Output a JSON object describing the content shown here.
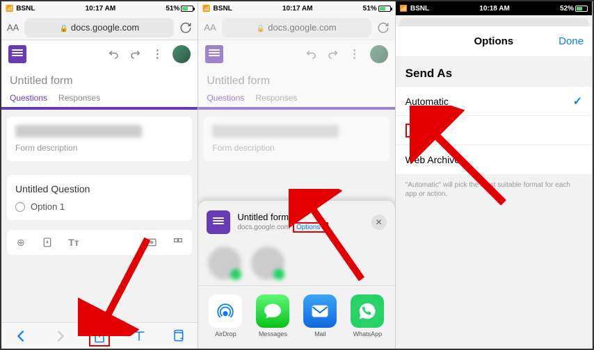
{
  "status": {
    "carrier": "BSNL",
    "time1": "10:17 AM",
    "time2": "10:17 AM",
    "time3": "10:18 AM",
    "battery1": "51%",
    "battery2": "51%",
    "battery3": "52%"
  },
  "url": "docs.google.com",
  "form_title": "Untitled form",
  "tabs": {
    "questions": "Questions",
    "responses": "Responses"
  },
  "card1": {
    "desc": "Form description"
  },
  "question": {
    "title": "Untitled Question",
    "option1": "Option 1"
  },
  "share": {
    "title": "Untitled form",
    "sub": "docs.google.com",
    "options_label": "Options",
    "apps": {
      "airdrop": "AirDrop",
      "messages": "Messages",
      "mail": "Mail",
      "whatsapp": "WhatsApp"
    }
  },
  "options": {
    "title": "Options",
    "done": "Done",
    "section": "Send As",
    "automatic": "Automatic",
    "pdf": "PDF",
    "web": "Web Archive",
    "footnote": "\"Automatic\" will pick the most suitable format for each app or action."
  }
}
